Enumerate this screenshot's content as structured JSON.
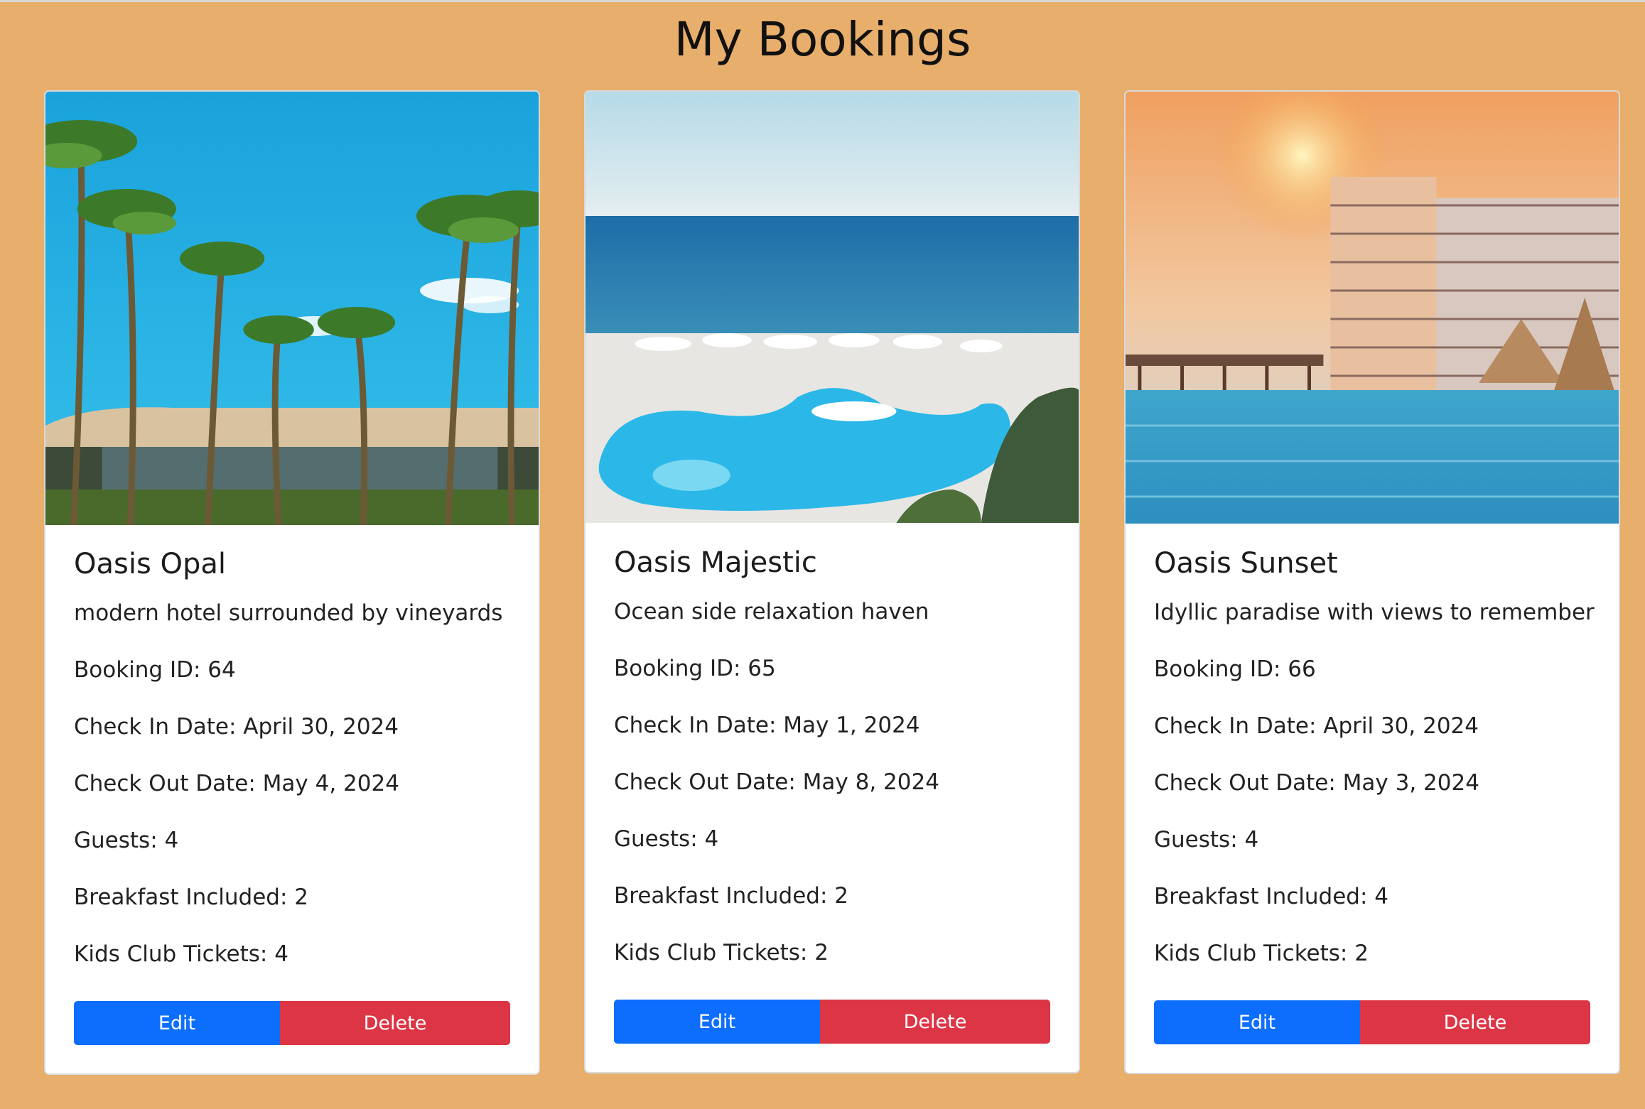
{
  "page": {
    "title": "My Bookings"
  },
  "colors": {
    "background": "#e8ae6b",
    "edit_button": "#0d6efd",
    "delete_button": "#dc3545"
  },
  "bookings": [
    {
      "name": "Oasis Opal",
      "description": "modern hotel surrounded by vineyards",
      "booking_id": "Booking ID: 64",
      "check_in": "Check In Date: April 30, 2024",
      "check_out": "Check Out Date: May 4, 2024",
      "guests": "Guests: 4",
      "breakfast": "Breakfast Included: 2",
      "kids_club": "Kids Club Tickets: 4",
      "edit_label": "Edit",
      "delete_label": "Delete",
      "image_icon": "palm-resort-image"
    },
    {
      "name": "Oasis Majestic",
      "description": "Ocean side relaxation haven",
      "booking_id": "Booking ID: 65",
      "check_in": "Check In Date: May 1, 2024",
      "check_out": "Check Out Date: May 8, 2024",
      "guests": "Guests: 4",
      "breakfast": "Breakfast Included: 2",
      "kids_club": "Kids Club Tickets: 2",
      "edit_label": "Edit",
      "delete_label": "Delete",
      "image_icon": "ocean-pool-image"
    },
    {
      "name": "Oasis Sunset",
      "description": "Idyllic paradise with views to remember",
      "booking_id": "Booking ID: 66",
      "check_in": "Check In Date: April 30, 2024",
      "check_out": "Check Out Date: May 3, 2024",
      "guests": "Guests: 4",
      "breakfast": "Breakfast Included: 4",
      "kids_club": "Kids Club Tickets: 2",
      "edit_label": "Edit",
      "delete_label": "Delete",
      "image_icon": "sunset-hotel-image"
    }
  ]
}
